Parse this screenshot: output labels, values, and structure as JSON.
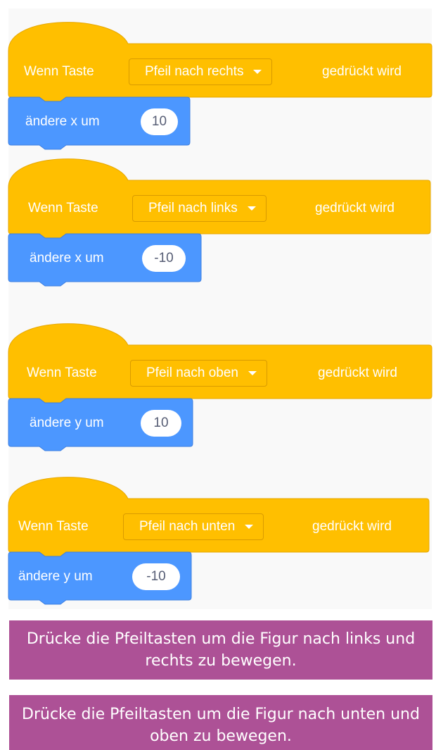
{
  "scripts": [
    {
      "hat": {
        "prefix": "Wenn Taste",
        "key": "Pfeil nach rechts",
        "suffix": "gedrückt wird"
      },
      "motion": {
        "label": "ändere x um",
        "value": "10"
      }
    },
    {
      "hat": {
        "prefix": "Wenn Taste",
        "key": "Pfeil nach links",
        "suffix": "gedrückt wird"
      },
      "motion": {
        "label": "ändere x um",
        "value": "-10"
      }
    },
    {
      "hat": {
        "prefix": "Wenn Taste",
        "key": "Pfeil nach oben",
        "suffix": "gedrückt wird"
      },
      "motion": {
        "label": "ändere y um",
        "value": "10"
      }
    },
    {
      "hat": {
        "prefix": "Wenn Taste",
        "key": "Pfeil nach unten",
        "suffix": "gedrückt wird"
      },
      "motion": {
        "label": "ändere y um",
        "value": "-10"
      }
    }
  ],
  "banners": [
    "Drücke die Pfeiltasten um die Figur nach links und rechts zu bewegen.",
    "Drücke die Pfeiltasten um die Figur nach unten und oben zu bewegen."
  ],
  "colors": {
    "events_block": "#ffbf00",
    "events_border": "#e6a700",
    "motion_block": "#4c97ff",
    "motion_border": "#3d7fe0",
    "banner": "#ad5196"
  }
}
